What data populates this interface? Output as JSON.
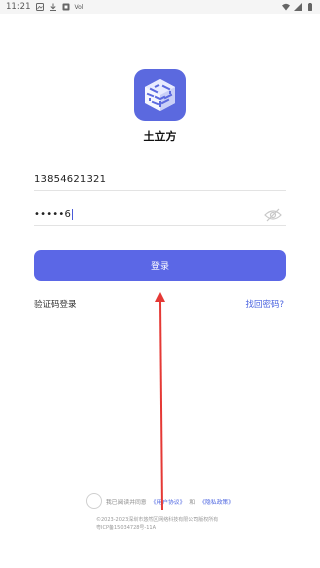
{
  "status_bar": {
    "time": "11:21",
    "extra_text": "Vol"
  },
  "app": {
    "name": "土立方",
    "brand_color": "#5b69df"
  },
  "form": {
    "phone_value": "13854621321",
    "password_value": "•••••6",
    "login_label": "登录",
    "sms_login_label": "验证码登录",
    "forgot_password_label": "找回密码?"
  },
  "agreement": {
    "prefix": "我已阅读并同意",
    "user_agreement": "《用户协议》",
    "and": "和",
    "privacy_policy": "《隐私政策》"
  },
  "footer": {
    "copyright_line1": "©2023-2023深圳市悠然区网络科技有限公司版权所有",
    "copyright_line2": "粤ICP备15034728号-11A"
  },
  "annotation": {
    "arrow_color": "#e53935",
    "icon": "arrow-up-annotation"
  }
}
